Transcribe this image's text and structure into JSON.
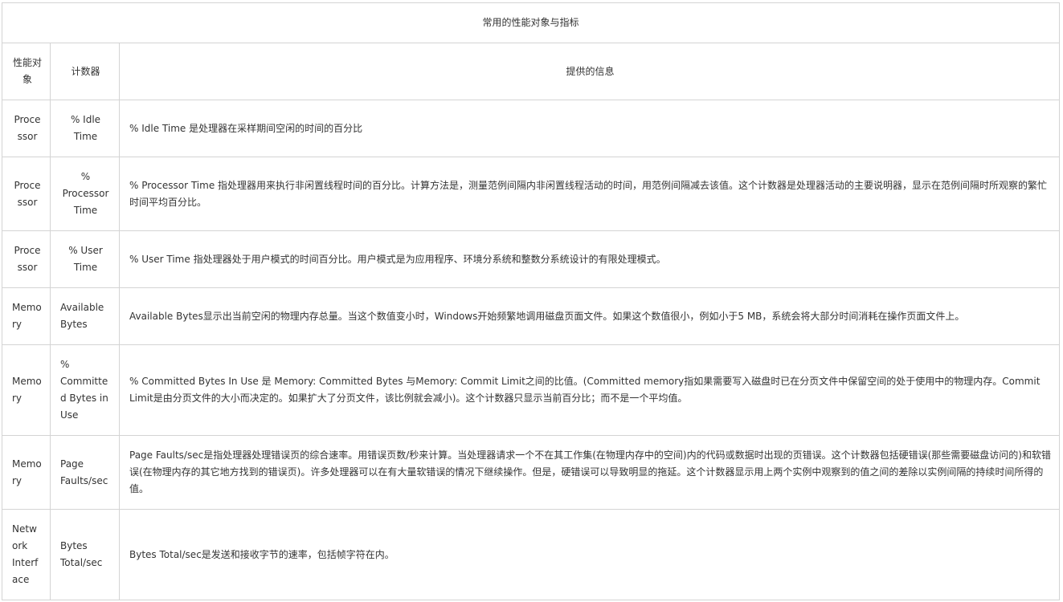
{
  "table": {
    "caption": "常用的性能对象与指标",
    "headers": {
      "object": "性能对象",
      "counter": "计数器",
      "info": "提供的信息"
    },
    "rows": [
      {
        "object": "Processor",
        "counter": "% Idle Time",
        "info": "% Idle Time 是处理器在采样期间空闲的时间的百分比"
      },
      {
        "object": "Processor",
        "counter": "% Processor Time",
        "info": "% Processor Time 指处理器用来执行非闲置线程时间的百分比。计算方法是，测量范例间隔内非闲置线程活动的时间，用范例间隔减去该值。这个计数器是处理器活动的主要说明器，显示在范例间隔时所观察的繁忙时间平均百分比。"
      },
      {
        "object": "Processor",
        "counter": "% User Time",
        "info": "% User Time 指处理器处于用户模式的时间百分比。用户模式是为应用程序、环境分系统和整数分系统设计的有限处理模式。"
      },
      {
        "object": "Memory",
        "counter": "Available Bytes",
        "info": "Available Bytes显示出当前空闲的物理内存总量。当这个数值变小时，Windows开始频繁地调用磁盘页面文件。如果这个数值很小，例如小于5 MB，系统会将大部分时间消耗在操作页面文件上。"
      },
      {
        "object": "Memory",
        "counter": "% Committed Bytes in Use",
        "info": "% Committed Bytes In Use 是 Memory: Committed Bytes 与Memory: Commit Limit之间的比值。(Committed memory指如果需要写入磁盘时已在分页文件中保留空间的处于使用中的物理内存。Commit Limit是由分页文件的大小而决定的。如果扩大了分页文件，该比例就会减小)。这个计数器只显示当前百分比；而不是一个平均值。"
      },
      {
        "object": "Memory",
        "counter": "Page Faults/sec",
        "info": "Page Faults/sec是指处理器处理错误页的综合速率。用错误页数/秒来计算。当处理器请求一个不在其工作集(在物理内存中的空间)内的代码或数据时出现的页错误。这个计数器包括硬错误(那些需要磁盘访问的)和软错误(在物理内存的其它地方找到的错误页)。许多处理器可以在有大量软错误的情况下继续操作。但是，硬错误可以导致明显的拖延。这个计数器显示用上两个实例中观察到的值之间的差除以实例间隔的持续时间所得的值。"
      },
      {
        "object": "Network Interface",
        "counter": "Bytes Total/sec",
        "info": "Bytes Total/sec是发送和接收字节的速率，包括帧字符在内。"
      }
    ]
  }
}
